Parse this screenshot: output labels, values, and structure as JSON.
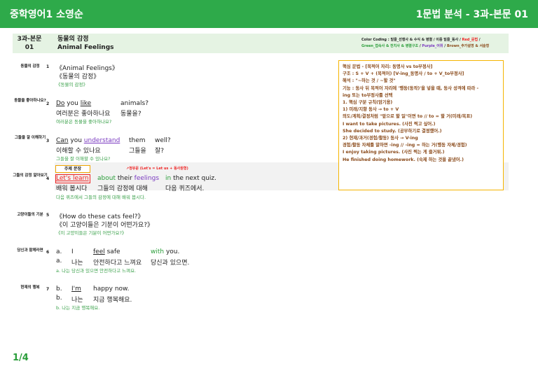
{
  "header": {
    "title": "중학영어1 소영순",
    "right": "1문법 분석 - 3과-본문 01"
  },
  "lesson": {
    "code_line1": "3과-본문",
    "code_line2": "01",
    "title_ko": "동물의 감정",
    "title_en": "Animal Feelings"
  },
  "color_coding": {
    "prefix": "Color Coding : 밑줄_선행사 & 수식 & 병렬 / 이중 밑줄_동사 / ",
    "red": "Red_문법",
    "sep1": " /",
    "green": "Green_접속사 & 전치사 & 병렬구조",
    "sep2": " / ",
    "purple": "Purple_어휘",
    "sep3": " / ",
    "brown": "Brown_추가설명 & 서술형"
  },
  "rows": [
    {
      "label": "동물의 감정",
      "num": "1",
      "en": "《Animal Feelings》",
      "ko": "《동물의 감정》",
      "trans": "《동물의 감정》"
    },
    {
      "label": "동물을 좋아하나요?",
      "num": "2",
      "en": [
        "Do",
        " you ",
        "like",
        "",
        "animals?"
      ],
      "ko": [
        "여러분은 좋아하나요",
        "동물을?"
      ],
      "trans": "여러분은 동물을 좋아하나요?"
    },
    {
      "label": "그들을 잘 이해하기",
      "num": "3",
      "en": [
        "Can",
        " you ",
        "understand",
        "them",
        "well?"
      ],
      "ko": [
        "이해할 수 있나요",
        "그들을",
        "잘?"
      ],
      "trans": "그들을 잘 이해할 수 있나요?"
    },
    {
      "label": "그들의 감정 알아보기",
      "num": "4",
      "topic": "주제 문장",
      "note": "↗청유문 (Let's = Let us + 동사원형)",
      "en": [
        "Let's learn",
        "about",
        " their ",
        "feelings",
        "in",
        " the next quiz."
      ],
      "ko": [
        "배워 봅시다",
        "그들의 감정에 대해",
        "다음 퀴즈에서."
      ],
      "trans": "다음 퀴즈에서 그들의 감정에 대해 배워 봅시다."
    },
    {
      "label": "고양이들의 기분",
      "num": "5",
      "en": "《How do these cats feel?》",
      "ko": "《이 고양이들은 기분이 어떤가요?》",
      "trans": "《이 고양이들은 기분이 어떤가요?》"
    },
    {
      "label": "당신과 함께라면",
      "num": "6",
      "en": [
        "a.",
        "I",
        "feel",
        " safe",
        "with",
        " you."
      ],
      "ko": [
        "a.",
        "나는",
        "안전하다고 느껴요",
        "당신과 있으면."
      ],
      "trans": "a. 나는 당신과 있으면 안전하다고 느껴요."
    },
    {
      "label": "현재의 행복",
      "num": "7",
      "en": [
        "b.",
        "I'm",
        "happy now."
      ],
      "ko": [
        "b.",
        "나는",
        "지금 행복해요."
      ],
      "trans": "b. 나는 지금 행복해요."
    }
  ],
  "grammar": [
    "핵심 문법 - [목적어 자리: 동명사 vs to부정사]",
    "구조 : S + V + (목적어) [V-ing_동명사 / to + V_to부정사]",
    "해석 : \"~하는 것 / ~할 것\"",
    "기능 : 동사 뒤 목적어 자리에 '행동(동작)'을 넣을 때, 동사 성격에 따라 -",
    "ing 또는 to부정사를 선택",
    "1. 핵심 구분 규칙(암기용)",
    "1) 미래/지향 동사 → to + V",
    "의도/계획/결정처럼 \"앞으로 할 일\"이면 to // to = 할 거(미래/목표)",
    "I want to take pictures. (사진 찍고 싶어.)",
    "She decided to study. (공부하기로 결정했어.)",
    "2) 현재/과거(경험/활동) 동사 → V-ing",
    "경험/활동 자체를 말하면 -ing // -ing = 하는 거(행동 자체/경험)",
    "I enjoy taking pictures. (사진 찍는 게 즐거워.)",
    "He finished doing homework. (숙제 하는 것을 끝냈어.)"
  ],
  "page": "1/4"
}
